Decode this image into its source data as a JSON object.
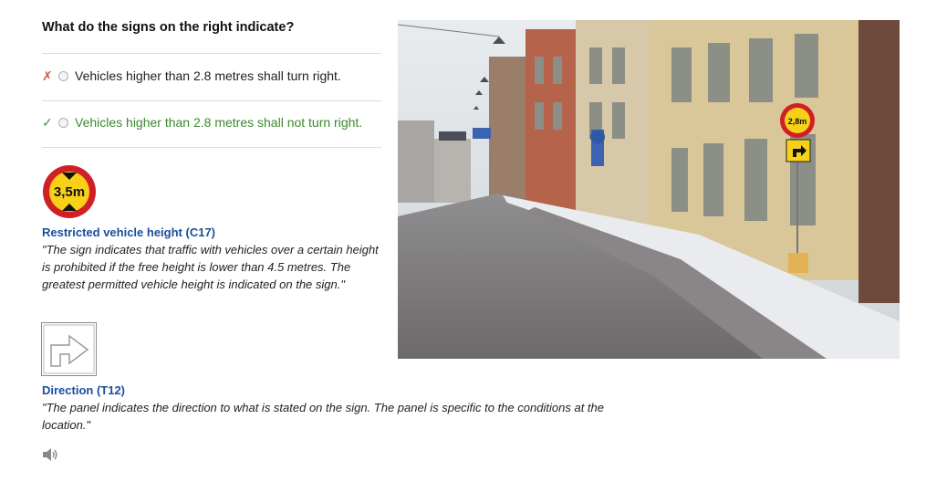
{
  "question": "What do the signs on the right indicate?",
  "options": [
    {
      "mark": "✗",
      "status": "wrong",
      "label": "Vehicles higher than 2.8 metres shall turn right."
    },
    {
      "mark": "✓",
      "status": "correct",
      "label": "Vehicles higher than 2.8 metres shall not turn right."
    }
  ],
  "signs": [
    {
      "icon": "height-limit-sign-icon",
      "sign_text": "3,5m",
      "title": "Restricted vehicle height (C17)",
      "description": "\"The sign indicates that traffic with vehicles over a certain height is prohibited if the free height is lower than 4.5 metres. The greatest permitted vehicle height is indicated on the sign.\""
    },
    {
      "icon": "direction-arrow-sign-icon",
      "title": "Direction (T12)",
      "description": "\"The panel indicates the direction to what is stated on the sign. The panel is specific to the conditions at the location.\""
    }
  ],
  "photo": {
    "sign_text": "2,8m",
    "description_icon": "street-photo"
  },
  "audio": {
    "icon": "speaker-icon"
  },
  "colors": {
    "wrong": "#d9534f",
    "correct": "#3a8a2a",
    "title": "#1a4f9c",
    "sign_yellow": "#f7d117",
    "sign_red": "#d11f26"
  }
}
